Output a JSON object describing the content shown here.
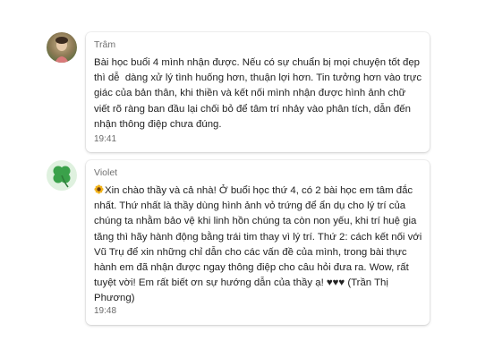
{
  "messages": [
    {
      "sender": "Trâm",
      "text": "Bài học buổi 4 mình nhận được. Nếu có sự chuẩn bị mọi chuyện tốt đẹp thì dễ  dàng xử lý tình huống hơn, thuận lợi hơn. Tin tưởng hơn vào trực giác của bản thân, khi thiền và kết nối mình nhận được hình ảnh chữ viết rõ ràng ban đầu lại chối bỏ để tâm trí nhảy vào phân tích, dẫn đến nhận thông điệp chưa đúng.",
      "time": "19:41",
      "avatar_icon": "profile-photo"
    },
    {
      "sender": "Violet",
      "emoji_icon": "sunflower-emoji",
      "text": "Xin chào thầy và cả nhà! Ở buổi học thứ 4, có 2 bài học em tâm đắc nhất. Thứ nhất là thầy dùng hình ảnh vỏ trứng để ẩn dụ cho lý trí của chúng ta nhằm bảo vệ khi linh hồn chúng ta còn non yếu, khi trí huệ gia tăng thì hãy hành động bằng trái tim thay vì lý trí. Thứ 2: cách kết nối với Vũ Trụ để xin những chỉ dẫn cho các vấn đề của mình, trong bài thực hành em đã nhận được ngay thông điệp cho câu hỏi đưa ra. Wow, rất tuyệt vời! Em rất biết ơn sự hướng dẫn của thầy ạ! ♥♥♥ (Trần Thị Phương)",
      "time": "19:48",
      "avatar_icon": "clover-avatar"
    }
  ],
  "colors": {
    "bubble_bg": "#ffffff",
    "sender_text": "#707070",
    "body_text": "#222222",
    "time_text": "#6b6b6b",
    "clover_green": "#3aa14a"
  }
}
